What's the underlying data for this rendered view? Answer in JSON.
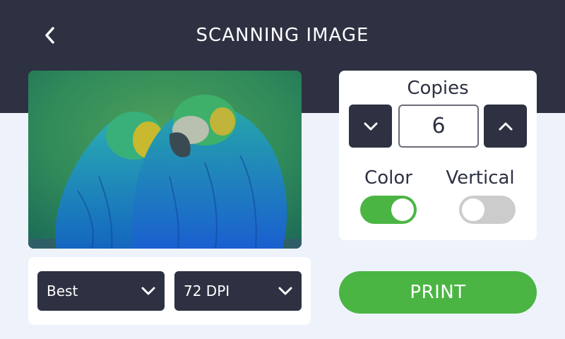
{
  "header": {
    "title": "SCANNING IMAGE",
    "back_icon": "chevron-left-icon"
  },
  "preview": {
    "subject": "two macaws"
  },
  "settings": {
    "quality": {
      "selected": "Best",
      "icon": "chevron-down-icon"
    },
    "resolution": {
      "selected": "72 DPI",
      "icon": "chevron-down-icon"
    }
  },
  "copies": {
    "label": "Copies",
    "value": "6",
    "decrement_icon": "chevron-down-icon",
    "increment_icon": "chevron-up-icon"
  },
  "toggles": {
    "color": {
      "label": "Color",
      "state": "on"
    },
    "vertical": {
      "label": "Vertical",
      "state": "off"
    }
  },
  "actions": {
    "print_label": "PRINT"
  },
  "colors": {
    "header_bg": "#2d3142",
    "page_bg": "#eef3fb",
    "accent_green": "#4bb543",
    "toggle_off": "#cccccc"
  }
}
